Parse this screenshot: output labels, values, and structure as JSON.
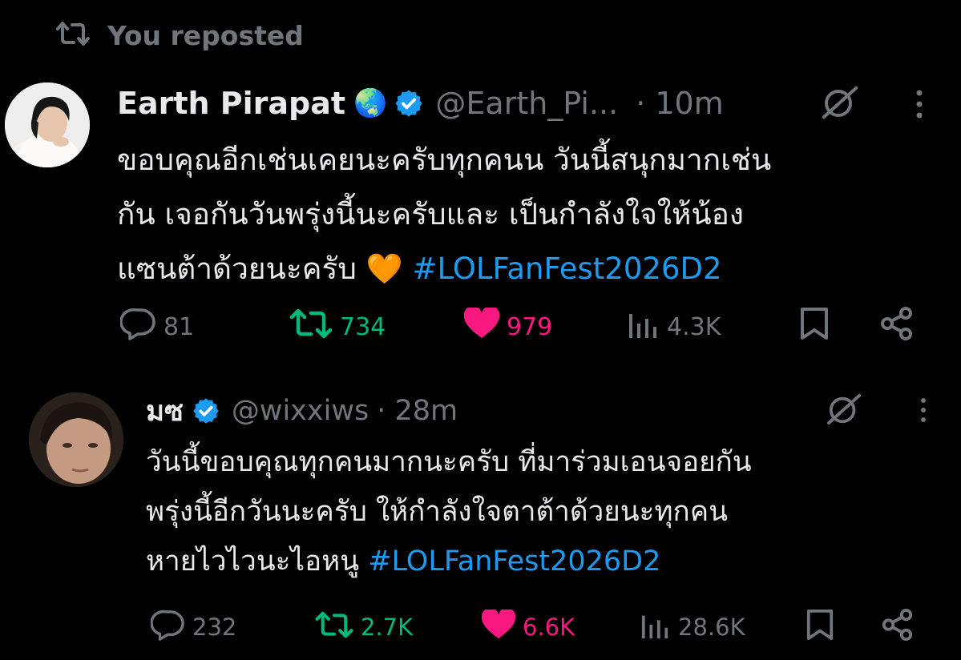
{
  "repost_banner": {
    "text": "You reposted"
  },
  "tweets": [
    {
      "author_name": "Earth Pirapat",
      "author_emoji": "🌏",
      "handle": "@Earth_Pi...",
      "time": "· 10m",
      "body": {
        "line1": "ขอบคุณอีกเช่นเคยนะครับทุกคนน วันนี้สนุกมากเช่น",
        "line2": "กัน เจอกันวันพรุ่งนี้นะครับและ เป็นกำลังใจให้น้อง",
        "line3_text": "แซนต้าด้วยนะครับ ",
        "line3_emoji": "🧡",
        "hashtag": "#LOLFanFest2026D2"
      },
      "stats": {
        "replies": "81",
        "reposts": "734",
        "likes": "979",
        "views": "4.3K"
      }
    },
    {
      "author_name": "มซ",
      "handle": "@wixxiws",
      "time": "· 28m",
      "body": {
        "line1": "วันนี้ขอบคุณทุกคนมากนะครับ ที่มาร่วมเอนจอยกัน",
        "line2": "พรุ่งนี้อีกวันนะครับ ให้กำลังใจตาต้าด้วยนะทุกคน",
        "line3_text": "หายไวไวนะไอหนู ",
        "hashtag": "#LOLFanFest2026D2"
      },
      "stats": {
        "replies": "232",
        "reposts": "2.7K",
        "likes": "6.6K",
        "views": "28.6K"
      }
    }
  ],
  "colors": {
    "background": "#000000",
    "text": "#e7e9ea",
    "muted": "#71767b",
    "link": "#1d9bf0",
    "repost_active": "#00ba7c",
    "like_active": "#f91880",
    "verified": "#1d9bf0"
  },
  "icons": [
    "repost-icon",
    "verified-badge-icon",
    "grok-icon",
    "more-icon",
    "reply-icon",
    "like-icon",
    "views-icon",
    "bookmark-icon",
    "share-icon"
  ]
}
